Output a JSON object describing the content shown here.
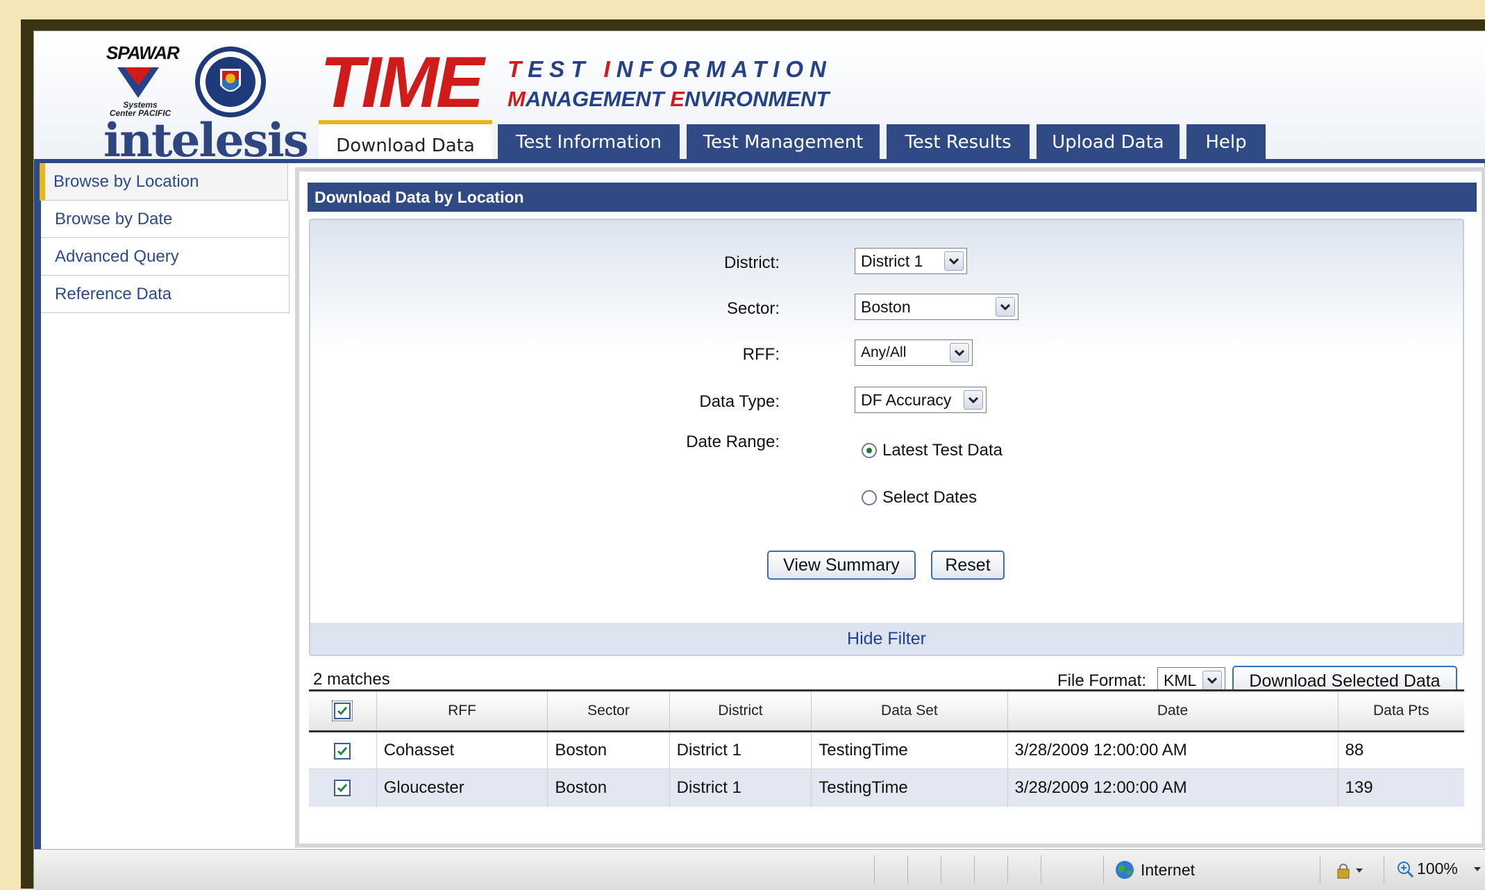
{
  "header": {
    "spawar": "SPAWAR",
    "systems_center": "Systems Center PACIFIC",
    "intelesis": "intelesis",
    "time_logo": "TIME",
    "subtitle_line1": "TEST INFORMATION",
    "subtitle_line2": "MANAGEMENT ENVIRONMENT"
  },
  "tabs": [
    {
      "label": "Download Data",
      "active": true
    },
    {
      "label": "Test Information"
    },
    {
      "label": "Test Management"
    },
    {
      "label": "Test Results"
    },
    {
      "label": "Upload Data"
    },
    {
      "label": "Help"
    }
  ],
  "sidebar": {
    "items": [
      {
        "label": "Browse by Location",
        "active": true
      },
      {
        "label": "Browse by Date"
      },
      {
        "label": "Advanced Query"
      },
      {
        "label": "Reference Data"
      }
    ]
  },
  "main": {
    "title": "Download Data by Location",
    "filter": {
      "district_label": "District:",
      "district_value": "District 1",
      "sector_label": "Sector:",
      "sector_value": "Boston",
      "rff_label": "RFF:",
      "rff_value": "Any/All",
      "data_type_label": "Data Type:",
      "data_type_value": "DF Accuracy",
      "date_range_label": "Date Range:",
      "radio_latest": "Latest Test Data",
      "radio_select": "Select Dates",
      "view_summary": "View Summary",
      "reset": "Reset",
      "hide_filter": "Hide Filter"
    },
    "results": {
      "matches": "2 matches",
      "file_format_label": "File Format:",
      "file_format_value": "KML",
      "download_button": "Download Selected Data",
      "columns": [
        "RFF",
        "Sector",
        "District",
        "Data Set",
        "Date",
        "Data Pts"
      ],
      "rows": [
        {
          "rff": "Cohasset",
          "sector": "Boston",
          "district": "District 1",
          "data_set": "TestingTime",
          "date": "3/28/2009 12:00:00 AM",
          "data_pts": "88"
        },
        {
          "rff": "Gloucester",
          "sector": "Boston",
          "district": "District 1",
          "data_set": "TestingTime",
          "date": "3/28/2009 12:00:00 AM",
          "data_pts": "139"
        }
      ]
    }
  },
  "statusbar": {
    "zone": "Internet",
    "zoom": "100%"
  },
  "colors": {
    "brand_blue": "#2f4a85",
    "accent_gold": "#e8b81a",
    "time_red": "#d01b1b"
  }
}
